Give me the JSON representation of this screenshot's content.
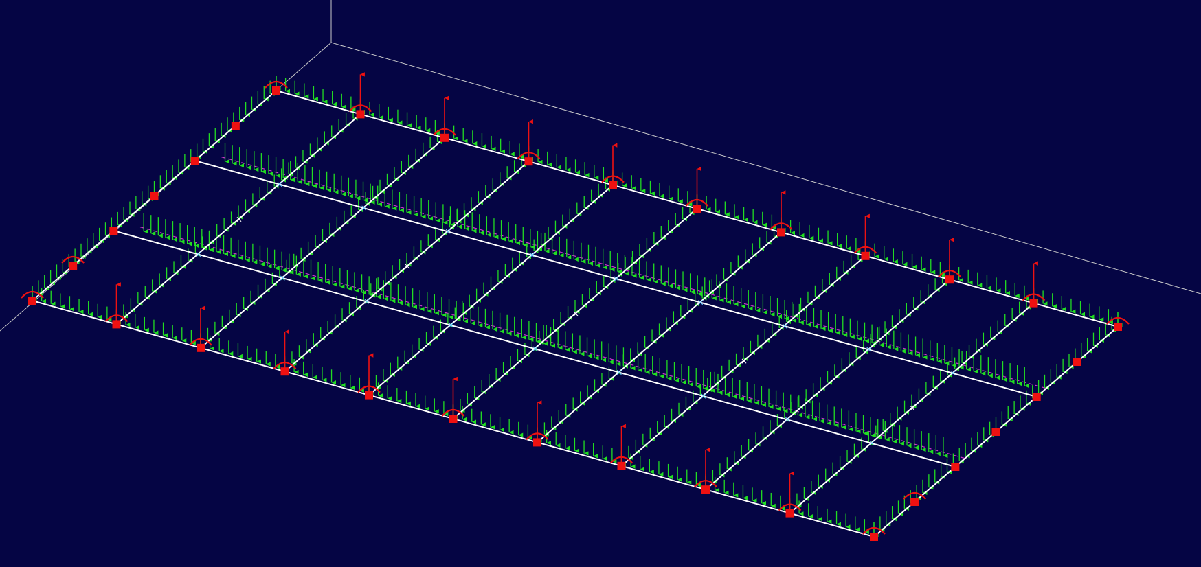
{
  "viewport": {
    "name": "structural-model-viewport",
    "view": "isometric",
    "colors": {
      "background": "#050544",
      "members": "#ffffff",
      "distributed_load": "#22dd22",
      "reactions": "#ee1111",
      "dashed_members": "#cc33cc",
      "node_markers": "#66ccff"
    },
    "icons": {
      "reaction_force": "up-arrow-icon",
      "reaction_moment": "curved-arrow-icon",
      "support": "red-square-icon",
      "member_midpoint": "x-marker-icon"
    }
  }
}
